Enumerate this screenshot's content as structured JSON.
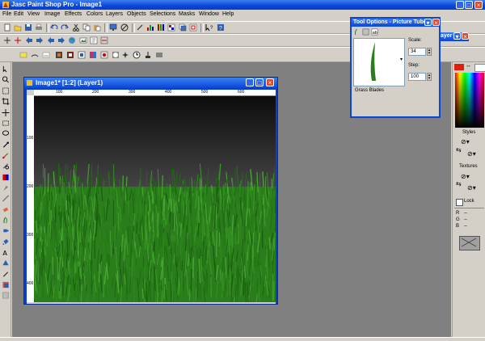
{
  "window": {
    "title": "Jasc Paint Shop Pro - Image1"
  },
  "menu": [
    "File",
    "Edit",
    "View",
    "Image",
    "Effects",
    "Colors",
    "Layers",
    "Objects",
    "Selections",
    "Masks",
    "Window",
    "Help"
  ],
  "image_window": {
    "title": "Image1* [1:2] (Layer1)",
    "ruler_h": [
      "100",
      "200",
      "300",
      "400",
      "500",
      "600"
    ],
    "ruler_v": [
      "100",
      "200",
      "300",
      "400"
    ]
  },
  "tool_options": {
    "title": "Tool Options - Picture Tube",
    "scale_label": "Scale:",
    "scale_value": "34",
    "step_label": "Step:",
    "step_value": "100",
    "tube_name": "Grass Blades"
  },
  "layer_palette": {
    "title_fragment": "ayer"
  },
  "materials": {
    "styles_label": "Styles",
    "textures_label": "Textures",
    "lock_label": "Lock",
    "r_label": "R",
    "g_label": "G",
    "b_label": "B",
    "rgb_value": "--",
    "foreground_color": "#e0200f",
    "background_color": "#ffffff"
  },
  "colors": {
    "title_blue": "#0a46d8",
    "workspace_gray": "#808080",
    "grass_green": "#2f8a1e",
    "sky_top": "#0c0c0c",
    "sky_bottom": "#8a8a8a"
  }
}
